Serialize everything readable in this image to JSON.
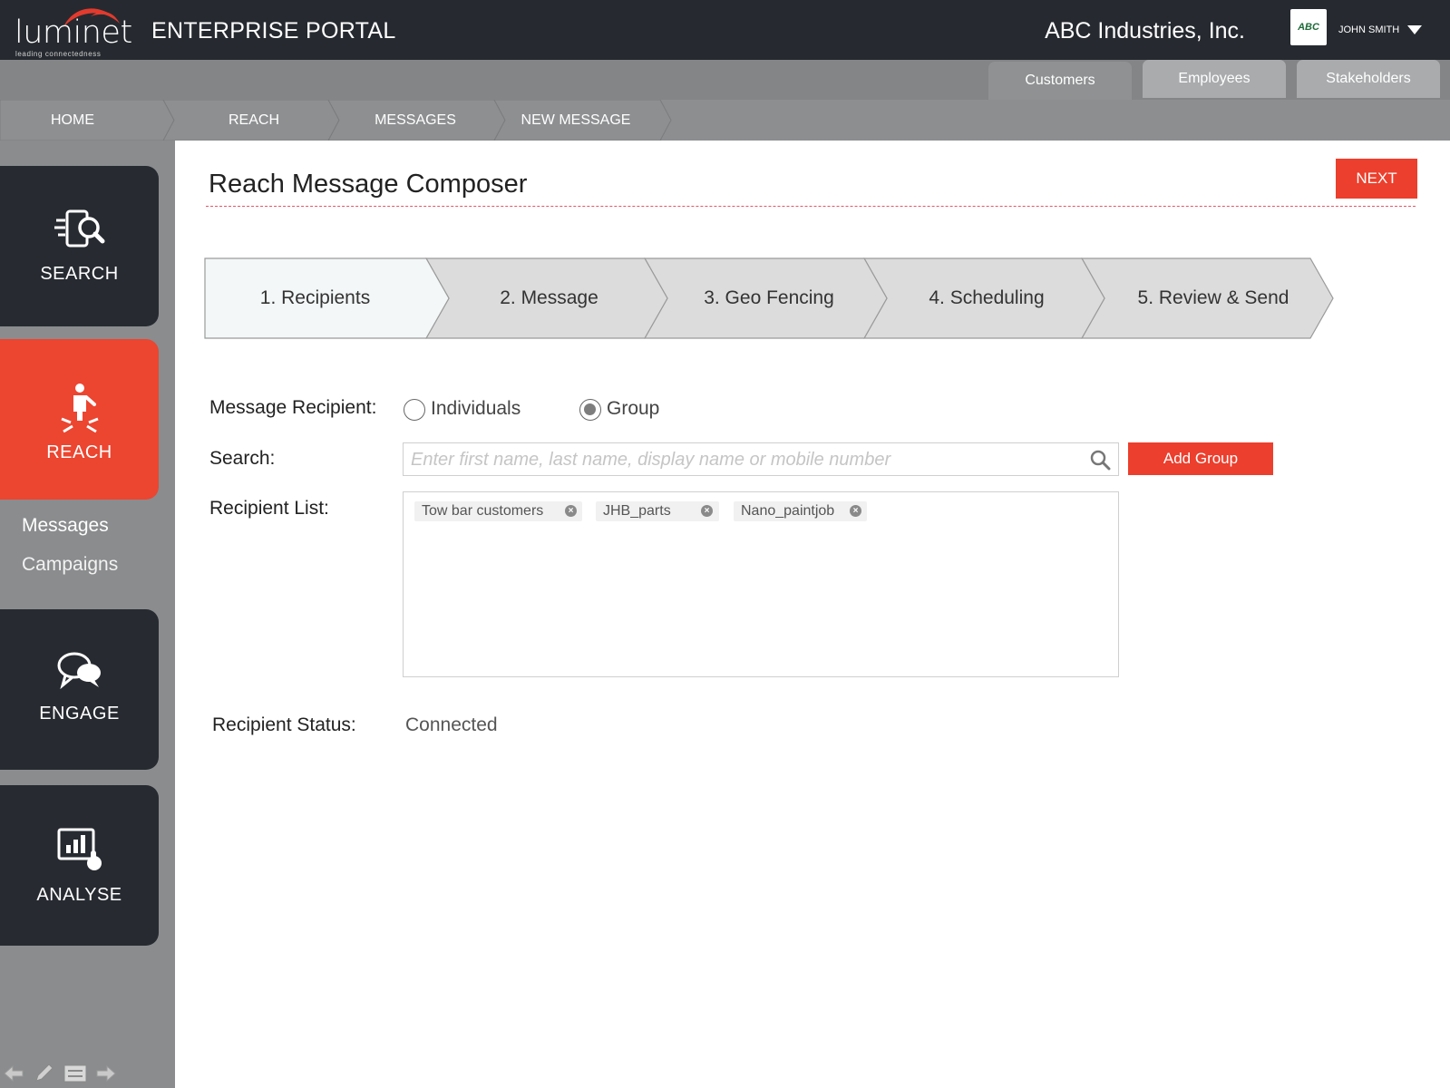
{
  "header": {
    "logo_text": "luminet",
    "logo_tagline": "leading connectedness",
    "portal_title": "ENTERPRISE PORTAL",
    "company_name": "ABC Industries, Inc.",
    "company_logo_text": "ABC",
    "user_name": "JOHN SMITH"
  },
  "tabs": [
    {
      "label": "Customers",
      "active": true
    },
    {
      "label": "Employees",
      "active": false
    },
    {
      "label": "Stakeholders",
      "active": false
    }
  ],
  "breadcrumb": [
    "HOME",
    "REACH",
    "MESSAGES",
    "NEW MESSAGE"
  ],
  "sidebar": {
    "items": [
      {
        "label": "SEARCH",
        "icon": "search-phone-icon",
        "active": false
      },
      {
        "label": "REACH",
        "icon": "person-reach-icon",
        "active": true
      },
      {
        "label": "ENGAGE",
        "icon": "chat-bubbles-icon",
        "active": false
      },
      {
        "label": "ANALYSE",
        "icon": "chart-touch-icon",
        "active": false
      }
    ],
    "subnav": [
      "Messages",
      "Campaigns"
    ]
  },
  "main": {
    "title": "Reach Message Composer",
    "next_label": "NEXT",
    "steps": [
      "1. Recipients",
      "2. Message",
      "3. Geo Fencing",
      "4. Scheduling",
      "5. Review & Send"
    ],
    "active_step": 0,
    "form": {
      "recipient_label": "Message Recipient:",
      "recipient_options": [
        "Individuals",
        "Group"
      ],
      "recipient_selected": "Group",
      "search_label": "Search:",
      "search_placeholder": "Enter first name, last name, display name or mobile number",
      "search_value": "",
      "add_group_label": "Add Group",
      "list_label": "Recipient List:",
      "recipients": [
        "Tow bar customers",
        "JHB_parts",
        "Nano_paintjob"
      ],
      "status_label": "Recipient Status:",
      "status_value": "Connected"
    }
  },
  "colors": {
    "accent_red": "#ec3f2d",
    "header_dark": "#262a30",
    "sidebar_gray": "#8a8c8e",
    "active_step_bg": "#f3f7f8",
    "step_bg": "#dcdcdc"
  }
}
